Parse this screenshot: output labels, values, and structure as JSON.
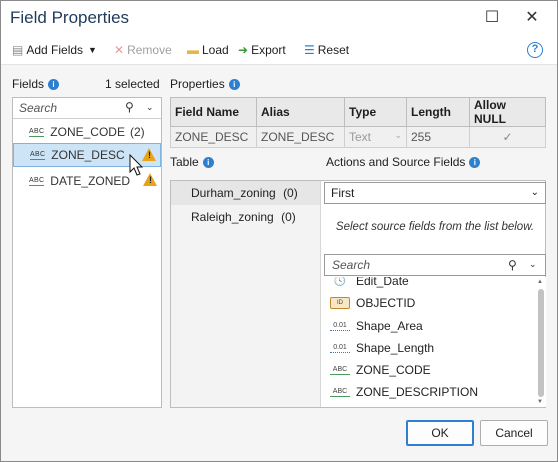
{
  "window": {
    "title": "Field Properties"
  },
  "toolbar": {
    "add_fields": "Add Fields",
    "remove": "Remove",
    "load": "Load",
    "export": "Export",
    "reset": "Reset"
  },
  "fields": {
    "label": "Fields",
    "selected_count": "1 selected",
    "search_placeholder": "Search",
    "items": [
      {
        "name": "ZONE_CODE",
        "count": "(2)",
        "warning": false
      },
      {
        "name": "ZONE_DESC",
        "count": "",
        "warning": true
      },
      {
        "name": "DATE_ZONED",
        "count": "",
        "warning": true
      }
    ]
  },
  "properties": {
    "label": "Properties",
    "headers": [
      "Field Name",
      "Alias",
      "Type",
      "Length",
      "Allow NULL"
    ],
    "row": {
      "field_name": "ZONE_DESC",
      "alias": "ZONE_DESC",
      "type": "Text",
      "length": "255",
      "allow_null": true
    }
  },
  "table": {
    "label": "Table",
    "items": [
      {
        "name": "Durham_zoning",
        "count": "(0)"
      },
      {
        "name": "Raleigh_zoning",
        "count": "(0)"
      }
    ]
  },
  "actions": {
    "label": "Actions and Source Fields",
    "merge_rule": "First",
    "hint": "Select source fields from the list below.",
    "search_placeholder": "Search",
    "source_fields": [
      {
        "name": "Edit_Date",
        "icon": "date-icon"
      },
      {
        "name": "OBJECTID",
        "icon": "objectid-icon"
      },
      {
        "name": "Shape_Area",
        "icon": "double-field-icon"
      },
      {
        "name": "Shape_Length",
        "icon": "double-field-icon"
      },
      {
        "name": "ZONE_CODE",
        "icon": "text-field-icon"
      },
      {
        "name": "ZONE_DESCRIPTION",
        "icon": "text-field-icon"
      }
    ]
  },
  "buttons": {
    "ok": "OK",
    "cancel": "Cancel"
  },
  "colors": {
    "accent": "#2e7fd0",
    "warning": "#e8a317",
    "selection": "#cde4f7"
  }
}
